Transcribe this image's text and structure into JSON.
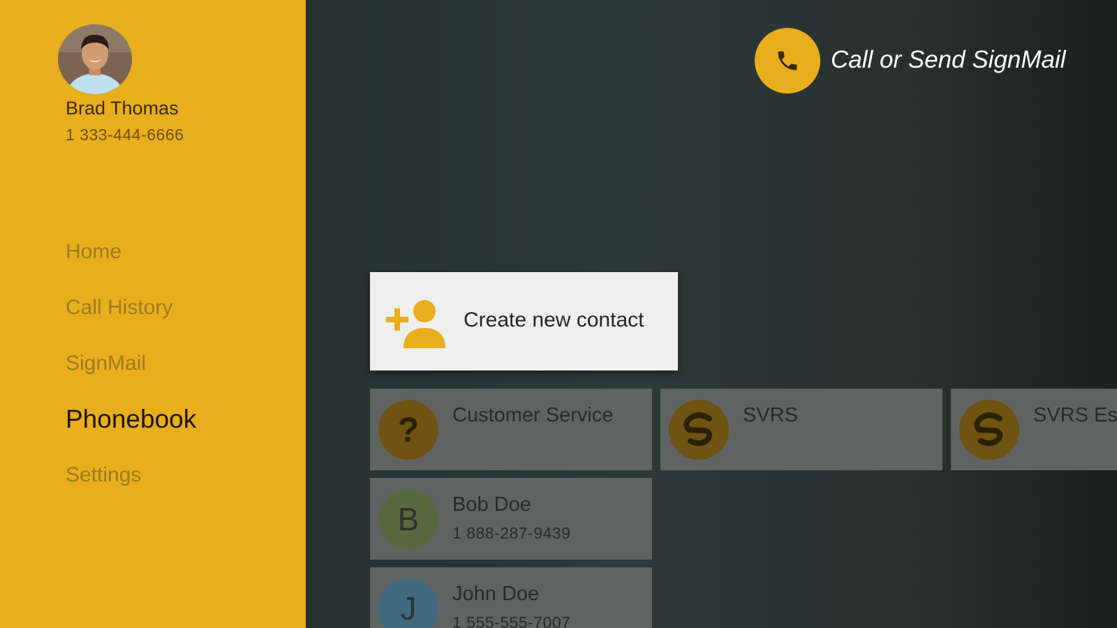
{
  "profile": {
    "name": "Brad Thomas",
    "phone": "1 333-444-6666"
  },
  "nav": {
    "items": [
      {
        "label": "Home"
      },
      {
        "label": "Call History"
      },
      {
        "label": "SignMail"
      },
      {
        "label": "Phonebook",
        "active": true
      },
      {
        "label": "Settings"
      }
    ]
  },
  "header": {
    "call_label": "Call or Send SignMail",
    "call_icon": "phone-icon"
  },
  "create_contact": {
    "label": "Create new contact",
    "icon": "add-person-icon"
  },
  "contacts": [
    {
      "name": "Customer Service",
      "phone": "",
      "icon": "question-icon"
    },
    {
      "name": "SVRS",
      "phone": "",
      "icon": "svrs-logo-icon"
    },
    {
      "name": "SVRS Es",
      "phone": "",
      "icon": "svrs-logo-icon"
    },
    {
      "name": "Bob Doe",
      "phone": "1 888-287-9439",
      "initial": "B"
    },
    {
      "name": "John Doe",
      "phone": "1 555-555-7007",
      "initial": "J"
    }
  ],
  "colors": {
    "accent": "#e8ae1c",
    "background": "#26312f",
    "card": "#5f6462",
    "bob_avatar": "#59693f",
    "john_avatar": "#3f6a80"
  }
}
